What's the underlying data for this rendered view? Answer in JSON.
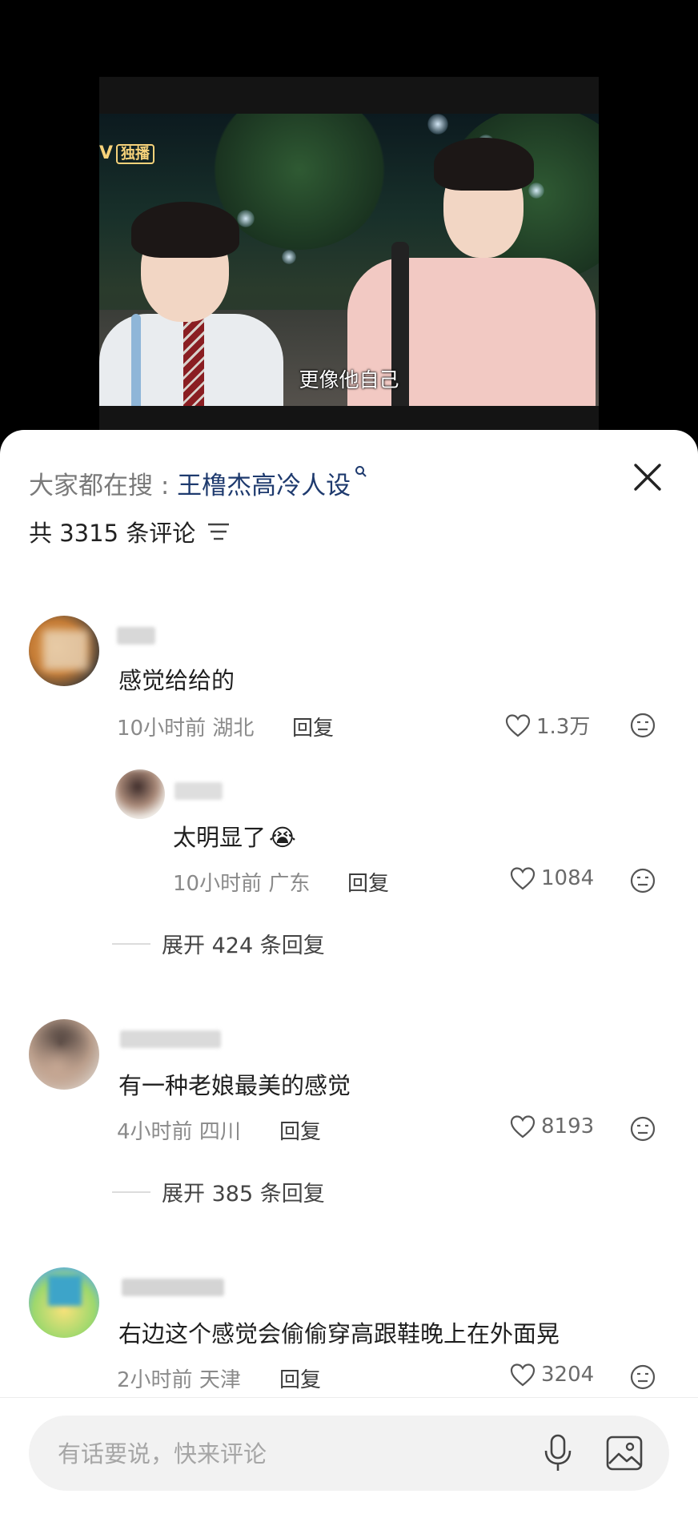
{
  "video": {
    "channel_badge": "V",
    "exclusive_label": "独播",
    "subtitle": "更像他自己"
  },
  "panel": {
    "search_prefix": "大家都在搜 : ",
    "search_keyword": "王橹杰高冷人设",
    "count_label": "共 3315 条评论"
  },
  "comments": [
    {
      "text": "感觉给给的",
      "time": "10小时前",
      "location": "湖北",
      "reply_label": "回复",
      "likes": "1.3万",
      "sub_reply": {
        "text": "太明显了",
        "emoji": "😭",
        "time": "10小时前",
        "location": "广东",
        "reply_label": "回复",
        "likes": "1084"
      },
      "expand_label": "展开 424 条回复"
    },
    {
      "text": "有一种老娘最美的感觉",
      "time": "4小时前",
      "location": "四川",
      "reply_label": "回复",
      "likes": "8193",
      "expand_label": "展开 385 条回复"
    },
    {
      "text": "右边这个感觉会偷偷穿高跟鞋晚上在外面晃",
      "time": "2小时前",
      "location": "天津",
      "reply_label": "回复",
      "likes": "3204"
    }
  ],
  "input": {
    "placeholder": "有话要说，快来评论"
  },
  "icons": {
    "close": "close-icon",
    "filter": "filter-icon",
    "like": "heart-icon",
    "dislike": "dislike-face-icon",
    "mic": "microphone-icon",
    "image": "image-icon"
  },
  "colors": {
    "keyword": "#1e3a6e",
    "meta": "#8a8a8a",
    "sheet_bg": "#ffffff",
    "input_bg": "#f2f2f2"
  }
}
